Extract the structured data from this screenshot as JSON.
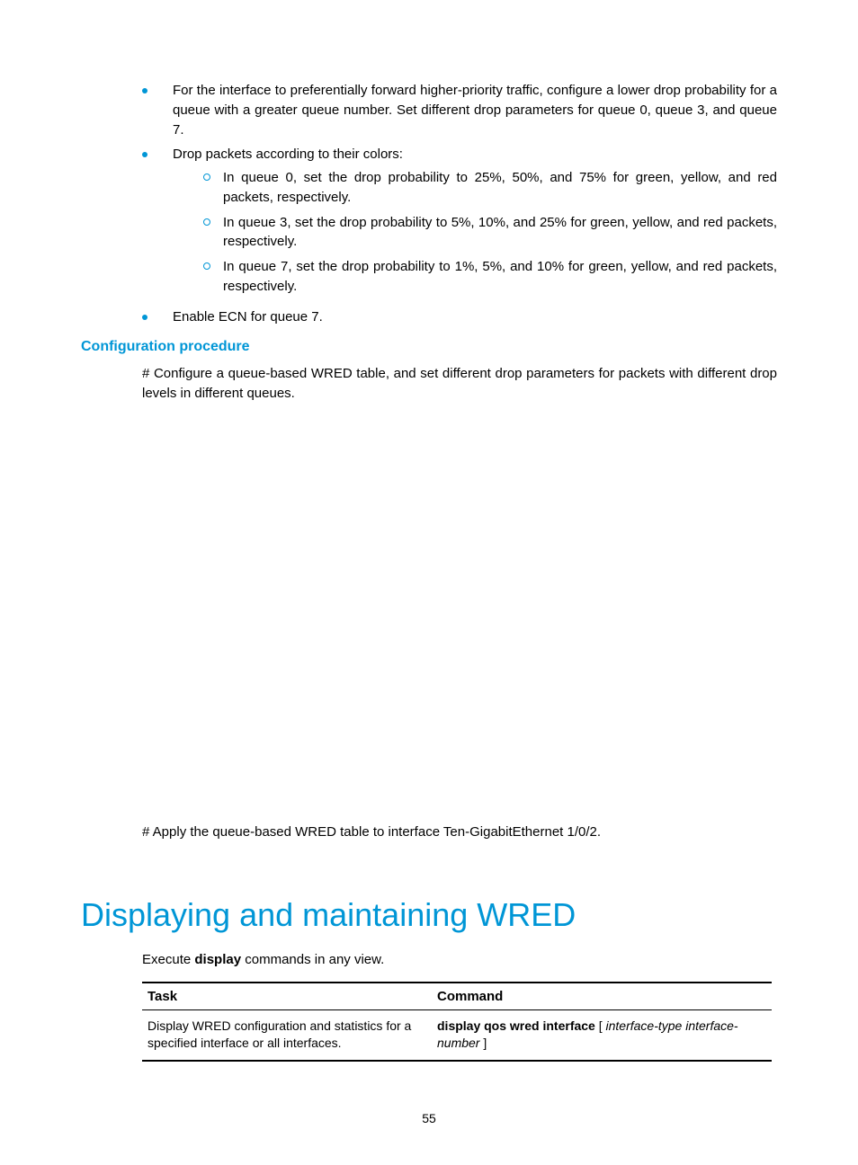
{
  "bullets": {
    "b1": "For the interface to preferentially forward higher-priority traffic, configure a lower drop probability for a queue with a greater queue number. Set different drop parameters for queue 0, queue 3, and queue 7.",
    "b2": "Drop packets according to their colors:",
    "b2_sub": {
      "s1": "In queue 0, set the drop probability to 25%, 50%, and 75% for green, yellow, and red packets, respectively.",
      "s2": "In queue 3, set the drop probability to 5%, 10%, and 25% for green, yellow, and red packets, respectively.",
      "s3": "In queue 7, set the drop probability to 1%, 5%, and 10% for green, yellow, and red packets, respectively."
    },
    "b3": "Enable ECN for queue 7."
  },
  "config_procedure": {
    "heading": "Configuration procedure",
    "para1": "# Configure a queue-based WRED table, and set different drop parameters for packets with different drop levels in different queues.",
    "para2": "# Apply the queue-based WRED table to interface Ten-GigabitEthernet 1/0/2."
  },
  "main_heading": "Displaying and maintaining WRED",
  "exec_sentence": {
    "prefix": "Execute ",
    "bold": "display",
    "suffix": " commands in any view."
  },
  "table": {
    "headers": {
      "task": "Task",
      "command": "Command"
    },
    "row": {
      "task": "Display WRED configuration and statistics for a specified interface or all interfaces.",
      "cmd_bold": "display qos wred interface",
      "cmd_bracket_open": " [ ",
      "cmd_italic1": "interface-type interface-number",
      "cmd_bracket_close": " ]"
    }
  },
  "page_number": "55"
}
